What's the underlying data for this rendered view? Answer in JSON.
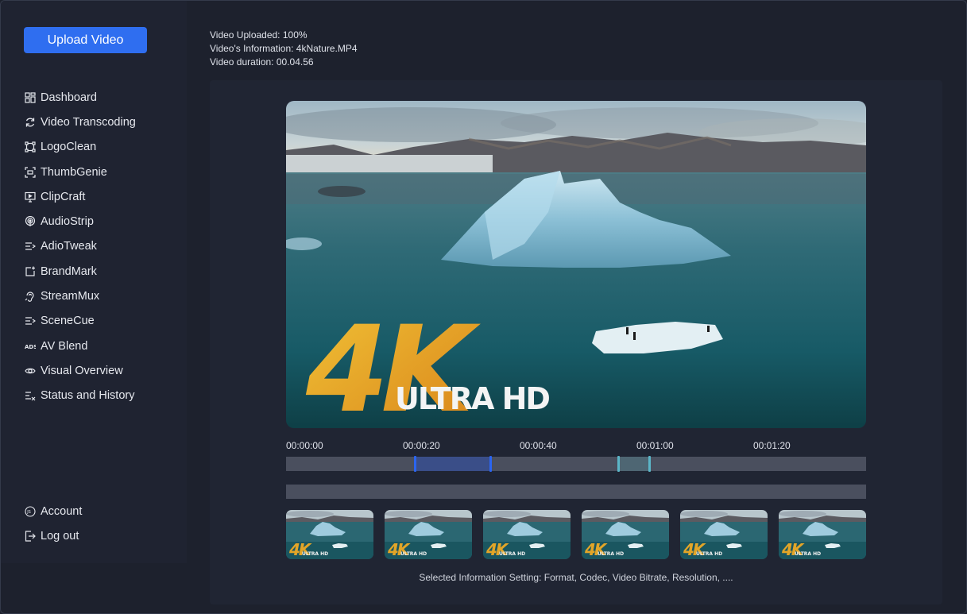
{
  "sidebar": {
    "upload_button": "Upload Video",
    "items": [
      {
        "label": "Dashboard",
        "icon": "dashboard-grid-icon"
      },
      {
        "label": "Video Transcoding",
        "icon": "refresh-icon"
      },
      {
        "label": "LogoClean",
        "icon": "crop-frame-icon"
      },
      {
        "label": "ThumbGenie",
        "icon": "scan-frame-icon"
      },
      {
        "label": "ClipCraft",
        "icon": "monitor-icon"
      },
      {
        "label": "AudioStrip",
        "icon": "podcast-icon"
      },
      {
        "label": "AdioTweak",
        "icon": "list-arrow-icon"
      },
      {
        "label": "BrandMark",
        "icon": "add-box-icon"
      },
      {
        "label": "StreamMux",
        "icon": "ear-icon"
      },
      {
        "label": "SceneCue",
        "icon": "list-arrow-icon"
      },
      {
        "label": "AV Blend",
        "icon": "ads-icon"
      },
      {
        "label": "Visual Overview",
        "icon": "eye-icon"
      },
      {
        "label": "Status and History",
        "icon": "list-check-icon"
      }
    ],
    "bottom_items": [
      {
        "label": "Account",
        "icon": "account-badge-icon",
        "badge": "JS"
      },
      {
        "label": "Log out",
        "icon": "logout-icon"
      }
    ]
  },
  "info": {
    "uploaded": "Video Uploaded: 100%",
    "information": "Video's Information: 4kNature.MP4",
    "duration": "Video duration: 00.04.56"
  },
  "video": {
    "badge_big": "4K",
    "badge_small": "ULTRA HD"
  },
  "timeline": {
    "labels": [
      "00:00:00",
      "00:00:20",
      "00:00:40",
      "00:01:00",
      "00:01:20"
    ],
    "accent": "#2f6ef0",
    "secondary_accent": "#5bb6c8"
  },
  "thumbnails": {
    "badge_big": "4K",
    "badge_small": "ULTRA HD"
  },
  "footer_note": "Selected Information Setting: Format, Codec, Video Bitrate, Resolution, ...."
}
